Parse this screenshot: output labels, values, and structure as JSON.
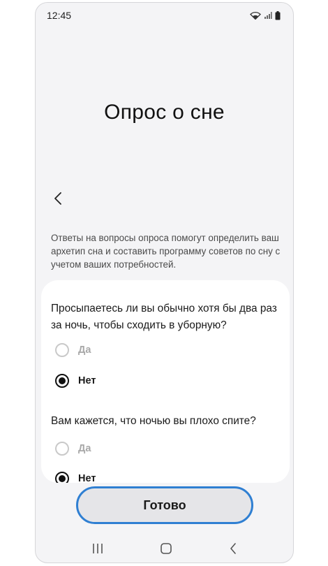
{
  "status_bar": {
    "time": "12:45",
    "icons": [
      "wifi-icon",
      "signal-icon",
      "battery-icon"
    ]
  },
  "page": {
    "title": "Опрос о сне",
    "intro": "Ответы на вопросы опроса помогут определить ваш архетип сна и составить программу советов по сну с учетом ваших потребностей."
  },
  "survey": {
    "questions": [
      {
        "text": "Просыпаетесь ли вы обычно хотя бы два раз за ночь, чтобы сходить в уборную?",
        "options": [
          {
            "label": "Да",
            "selected": false
          },
          {
            "label": "Нет",
            "selected": true
          }
        ]
      },
      {
        "text": "Вам кажется, что ночью вы плохо спите?",
        "options": [
          {
            "label": "Да",
            "selected": false
          },
          {
            "label": "Нет",
            "selected": true
          }
        ]
      }
    ]
  },
  "footer": {
    "done_label": "Готово"
  },
  "nav": {
    "icons": [
      "recents-icon",
      "home-icon",
      "back-nav-icon"
    ]
  },
  "colors": {
    "accent_outline": "#2f7fd2",
    "background": "#f4f4f6",
    "card": "#ffffff"
  }
}
